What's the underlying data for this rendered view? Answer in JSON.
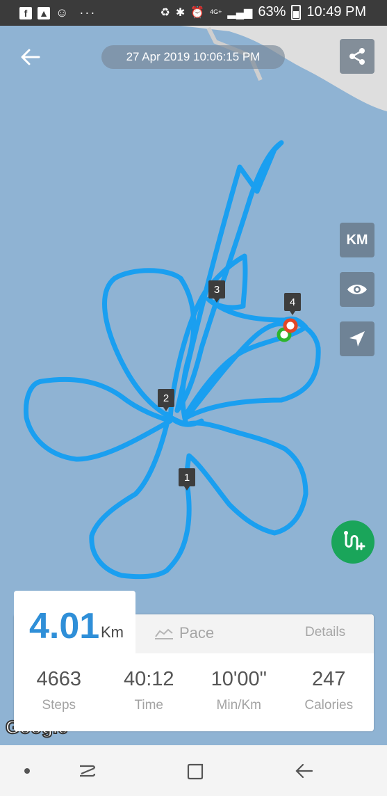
{
  "status_bar": {
    "left_icons": [
      "facebook-icon",
      "gallery-icon",
      "sonic-icon"
    ],
    "more_dots": "···",
    "network": "4G+",
    "battery": "63%",
    "time": "10:49 PM"
  },
  "header": {
    "datetime": "27 Apr 2019 10:06:15 PM"
  },
  "map_controls": {
    "unit_button": "KM"
  },
  "km_markers": [
    "1",
    "2",
    "3",
    "4"
  ],
  "summary": {
    "distance": "4.01",
    "distance_unit": "Km",
    "pace_tab": "Pace",
    "details_link": "Details",
    "stats": [
      {
        "value": "4663",
        "label": "Steps"
      },
      {
        "value": "40:12",
        "label": "Time"
      },
      {
        "value": "10'00\"",
        "label": "Min/Km"
      },
      {
        "value": "247",
        "label": "Calories"
      }
    ]
  },
  "colors": {
    "route": "#1a9ff0",
    "distance_text": "#2f8fd8",
    "route_add_button": "#1aa55a",
    "map_water": "#8fb3d3",
    "start_marker": "#2cb52c",
    "end_marker": "#e34727"
  }
}
